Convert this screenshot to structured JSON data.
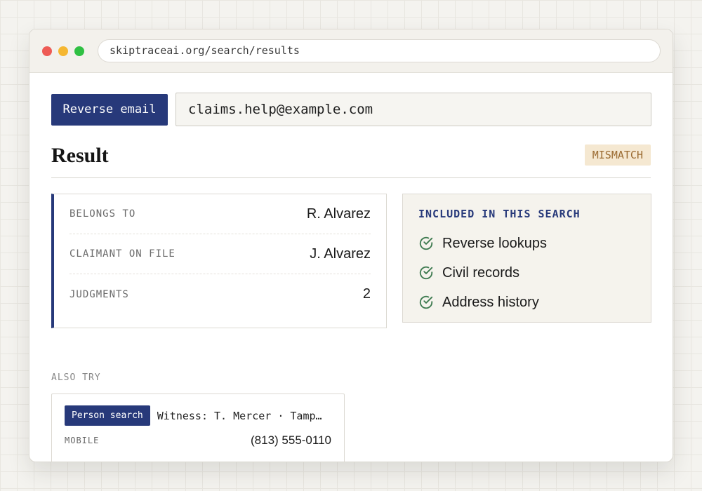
{
  "browser": {
    "url": "skiptraceai.org/search/results"
  },
  "search": {
    "mode_label": "Reverse email",
    "query": "claims.help@example.com"
  },
  "result": {
    "title": "Result",
    "status_badge": "MISMATCH",
    "fields": [
      {
        "label": "BELONGS TO",
        "value": "R. Alvarez"
      },
      {
        "label": "CLAIMANT ON FILE",
        "value": "J. Alvarez"
      },
      {
        "label": "JUDGMENTS",
        "value": "2"
      }
    ]
  },
  "included": {
    "heading": "INCLUDED IN THIS SEARCH",
    "icon": "check-circle-icon",
    "items": [
      "Reverse lookups",
      "Civil records",
      "Address history"
    ]
  },
  "also_try": {
    "label": "ALSO TRY",
    "chip": "Person search",
    "description": "Witness: T. Mercer · Tampa, FL",
    "field_label": "MOBILE",
    "field_value": "(813) 555-0110"
  },
  "colors": {
    "accent": "#27397a",
    "badge_bg": "#f5e8d1",
    "badge_text": "#9a6a30",
    "check": "#3d7a4f"
  }
}
